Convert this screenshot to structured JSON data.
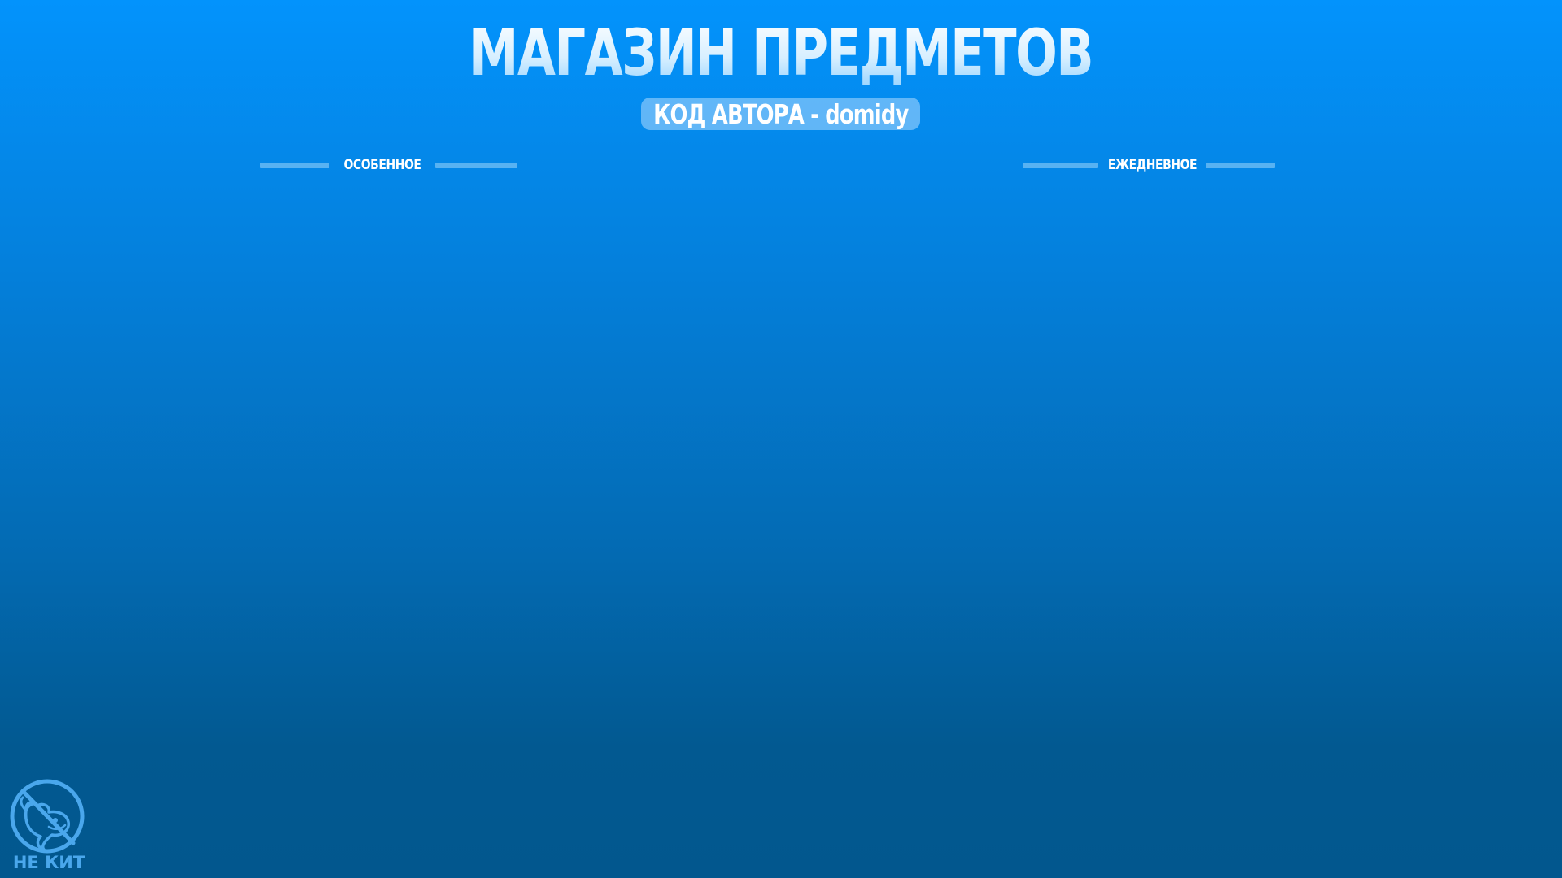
{
  "header": {
    "title": "МАГАЗИН ПРЕДМЕТОВ",
    "creator_code": "КОД АВТОРА - domidy"
  },
  "sections": {
    "featured": "ОСОБЕННОЕ",
    "daily": "ЕЖЕДНЕВНОЕ"
  },
  "logo": {
    "label": "НЕ КИТ",
    "icon": "crossed-out-whale-icon"
  },
  "colors": {
    "background_top": "#0393fc",
    "background_bottom": "#02578e",
    "accent_line": "#58b2f2",
    "pill": "#8fcaf7",
    "logo": "#4aa7ec"
  }
}
